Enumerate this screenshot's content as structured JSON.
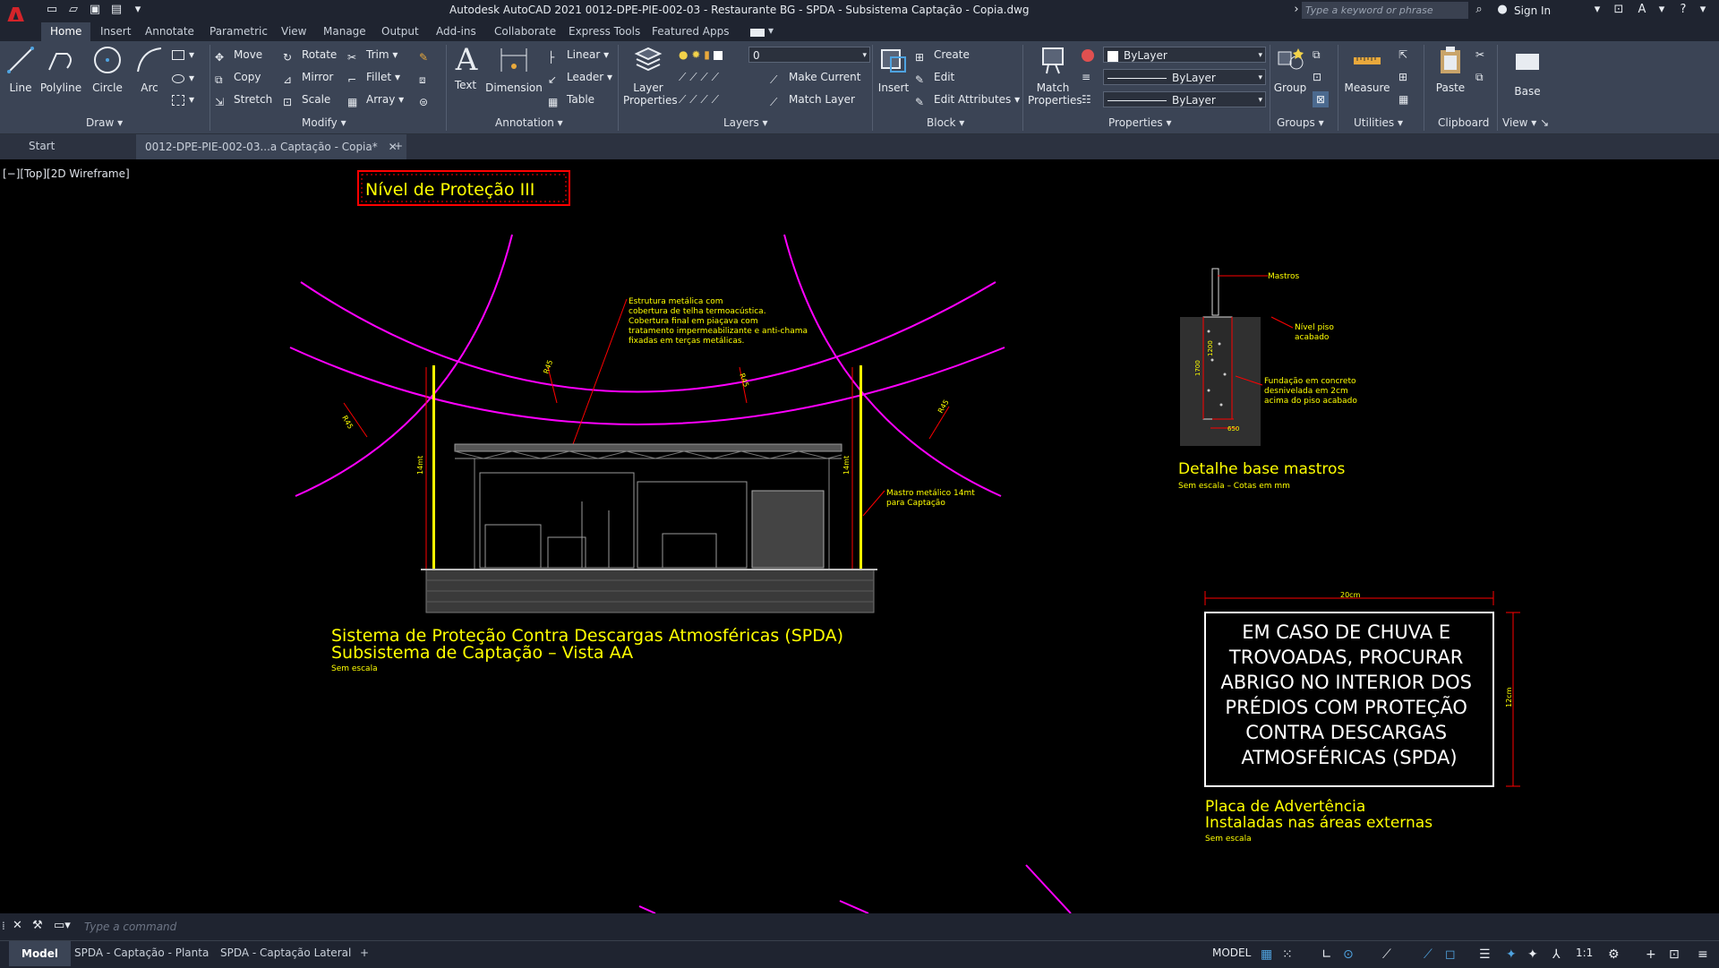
{
  "app": {
    "title": "Autodesk AutoCAD 2021    0012-DPE-PIE-002-03 - Restaurante BG - SPDA - Subsistema Captação - Copia.dwg",
    "logo": "A",
    "search_placeholder": "Type a keyword or phrase",
    "sign_in": "Sign In"
  },
  "colors": {
    "accent": "#d4242a",
    "drawing_yellow": "#ffff00",
    "drawing_magenta": "#ff00ff",
    "drawing_red": "#ff0000",
    "ribbon_bg": "#3b4455"
  },
  "ribbon_tabs": [
    "Home",
    "Insert",
    "Annotate",
    "Parametric",
    "View",
    "Manage",
    "Output",
    "Add-ins",
    "Collaborate",
    "Express Tools",
    "Featured Apps"
  ],
  "draw_panel": {
    "title": "Draw",
    "tools": [
      "Line",
      "Polyline",
      "Circle",
      "Arc"
    ]
  },
  "modify_panel": {
    "title": "Modify",
    "row1": [
      "Move",
      "Rotate",
      "Trim"
    ],
    "row2": [
      "Copy",
      "Mirror",
      "Fillet"
    ],
    "row3": [
      "Stretch",
      "Scale",
      "Array"
    ]
  },
  "annotation_panel": {
    "title": "Annotation",
    "big": [
      "Text",
      "Dimension"
    ],
    "small": [
      "Linear",
      "Leader",
      "Table"
    ]
  },
  "layers_panel": {
    "title": "Layers",
    "big_line1": "Layer",
    "big_line2": "Properties",
    "current_layer": "0",
    "make_current": "Make Current",
    "match_layer": "Match Layer"
  },
  "block_panel": {
    "title": "Block",
    "insert": "Insert",
    "create": "Create",
    "edit": "Edit",
    "edit_attributes": "Edit Attributes"
  },
  "properties_panel": {
    "title": "Properties",
    "match_line1": "Match",
    "match_line2": "Properties",
    "color": "ByLayer",
    "lineweight": "ByLayer",
    "linetype": "ByLayer"
  },
  "groups_panel": {
    "title": "Groups",
    "group": "Group"
  },
  "utilities_panel": {
    "title": "Utilities",
    "measure": "Measure"
  },
  "clipboard_panel": {
    "title": "Clipboard",
    "paste": "Paste"
  },
  "view_panel": {
    "title": "View",
    "base": "Base"
  },
  "doc_tabs": {
    "start": "Start",
    "current": "0012-DPE-PIE-002-03...a Captação - Copia*"
  },
  "viewport_label": "[−][Top][2D Wireframe]",
  "drawing": {
    "level_box": "Nível de Proteção III",
    "structure_note": [
      "Estrutura metálica com",
      "cobertura de telha termoacústica.",
      "Cobertura final em piaçava com",
      "tratamento impermeabilizante e anti-chama",
      "fixadas em terças metálicas."
    ],
    "radius_label": "R45",
    "height_label": "14mt",
    "mast_note": [
      "Mastro metálico 14mt",
      "para Captação"
    ],
    "main_title_1": "Sistema de Proteção Contra Descargas Atmosféricas (SPDA)",
    "main_title_2": "Subsistema de Captação – Vista AA",
    "scale_note": "Sem escala",
    "detail_mastros": "Mastros",
    "detail_floor": [
      "Nível piso",
      "acabado"
    ],
    "detail_foundation": [
      "Fundação em concreto",
      "desnivelada em 2cm",
      "acima do piso acabado"
    ],
    "detail_dims": [
      "1200",
      "1700",
      "650"
    ],
    "detail_title": "Detalhe base mastros",
    "detail_sub": "Sem escala – Cotas em mm",
    "sign_width": "20cm",
    "sign_height": "12cm",
    "sign_lines": [
      "EM CASO DE CHUVA E",
      "TROVOADAS, PROCURAR",
      "ABRIGO NO INTERIOR DOS",
      "PRÉDIOS COM PROTEÇÃO",
      "CONTRA DESCARGAS",
      "ATMOSFÉRICAS (SPDA)"
    ],
    "sign_title_1": "Placa de Advertência",
    "sign_title_2": "Instaladas nas áreas externas",
    "sign_scale": "Sem escala"
  },
  "command_line": {
    "placeholder": "Type a command"
  },
  "layout_tabs": [
    "Model",
    "SPDA - Captação - Planta",
    "SPDA - Captação Lateral"
  ],
  "status": {
    "mode": "MODEL",
    "scale": "1:1"
  }
}
